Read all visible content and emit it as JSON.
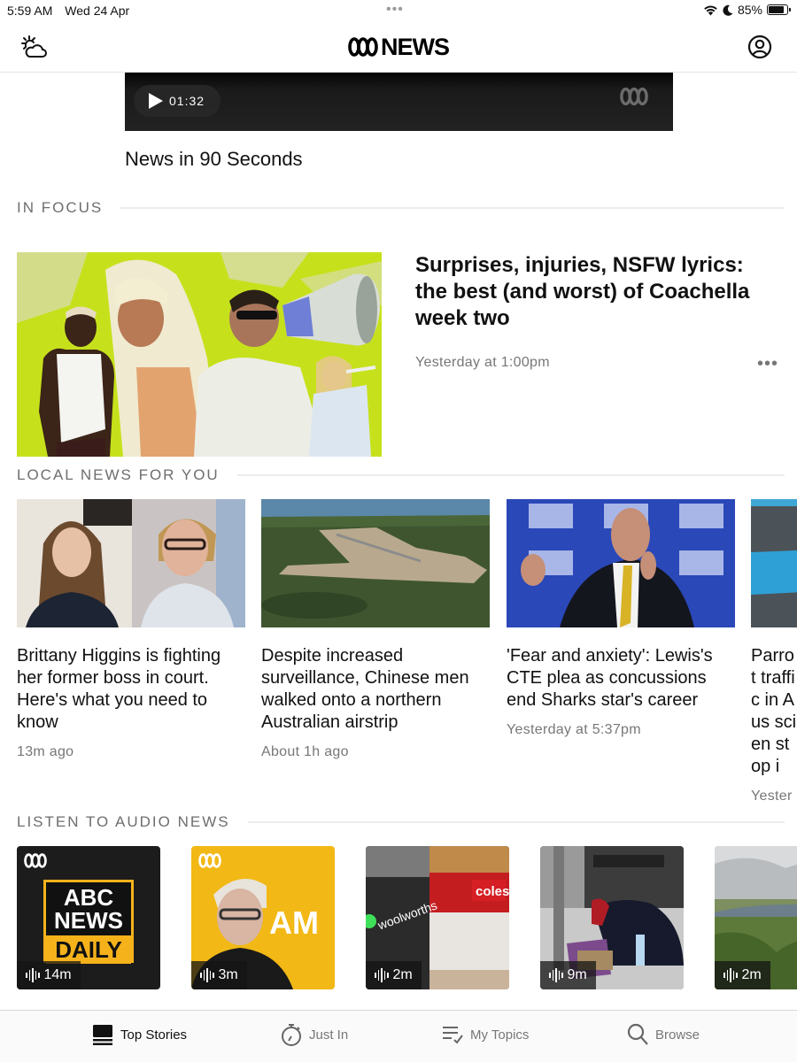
{
  "status_bar": {
    "time": "5:59 AM",
    "date": "Wed 24 Apr",
    "multitask_dots": "•••",
    "battery": "85%",
    "battery_level": 0.85
  },
  "header": {
    "logo_text": "NEWS",
    "weather_icon": "weather-partly-cloudy-icon",
    "profile_icon": "user-circle-icon"
  },
  "video": {
    "duration": "01:32",
    "title": "News in 90 Seconds"
  },
  "in_focus": {
    "section_label": "IN FOCUS",
    "title": "Surprises, injuries, NSFW lyrics: the best (and worst) of Coachella week two",
    "time": "Yesterday at 1:00pm",
    "more_label": "•••",
    "image_desc": "Collage of Coachella performers on lime green background"
  },
  "local_news": {
    "section_label": "LOCAL NEWS FOR YOU",
    "items": [
      {
        "title": "Brittany Higgins is fighting her former boss in court. Here's what you need to know",
        "time": "13m ago",
        "image_desc": "Two women portraits"
      },
      {
        "title": "Despite increased surveillance, Chinese men walked onto a northern Australian airstrip",
        "time": "About 1h ago",
        "image_desc": "Aerial view of airstrip in forest"
      },
      {
        "title": "'Fear and anxiety': Lewis's CTE plea as concussions end Sharks star's career",
        "time": "Yesterday at 5:37pm",
        "image_desc": "Man speaking at National Press Club"
      },
      {
        "title": "Parrot traffic in Aus scien stop i",
        "time": "Yester",
        "image_desc": "Blue object close-up"
      }
    ]
  },
  "audio_news": {
    "section_label": "LISTEN TO AUDIO NEWS",
    "items": [
      {
        "duration": "14m",
        "name": "ABC News Daily",
        "art_line1": "ABC",
        "art_line2": "NEWS",
        "art_line3": "DAILY"
      },
      {
        "duration": "3m",
        "name": "AM",
        "art_text": "AM"
      },
      {
        "duration": "2m",
        "name": "Woolworths and Coles",
        "sign1": "woolworths",
        "sign2": "coles"
      },
      {
        "duration": "9m",
        "name": "Homelessness"
      },
      {
        "duration": "2m",
        "name": "Rainforest landscape"
      }
    ]
  },
  "tab_bar": {
    "tabs": [
      {
        "label": "Top Stories",
        "icon": "top-stories-icon",
        "active": true
      },
      {
        "label": "Just In",
        "icon": "stopwatch-icon",
        "active": false
      },
      {
        "label": "My Topics",
        "icon": "list-check-icon",
        "active": false
      },
      {
        "label": "Browse",
        "icon": "search-icon",
        "active": false
      }
    ]
  }
}
